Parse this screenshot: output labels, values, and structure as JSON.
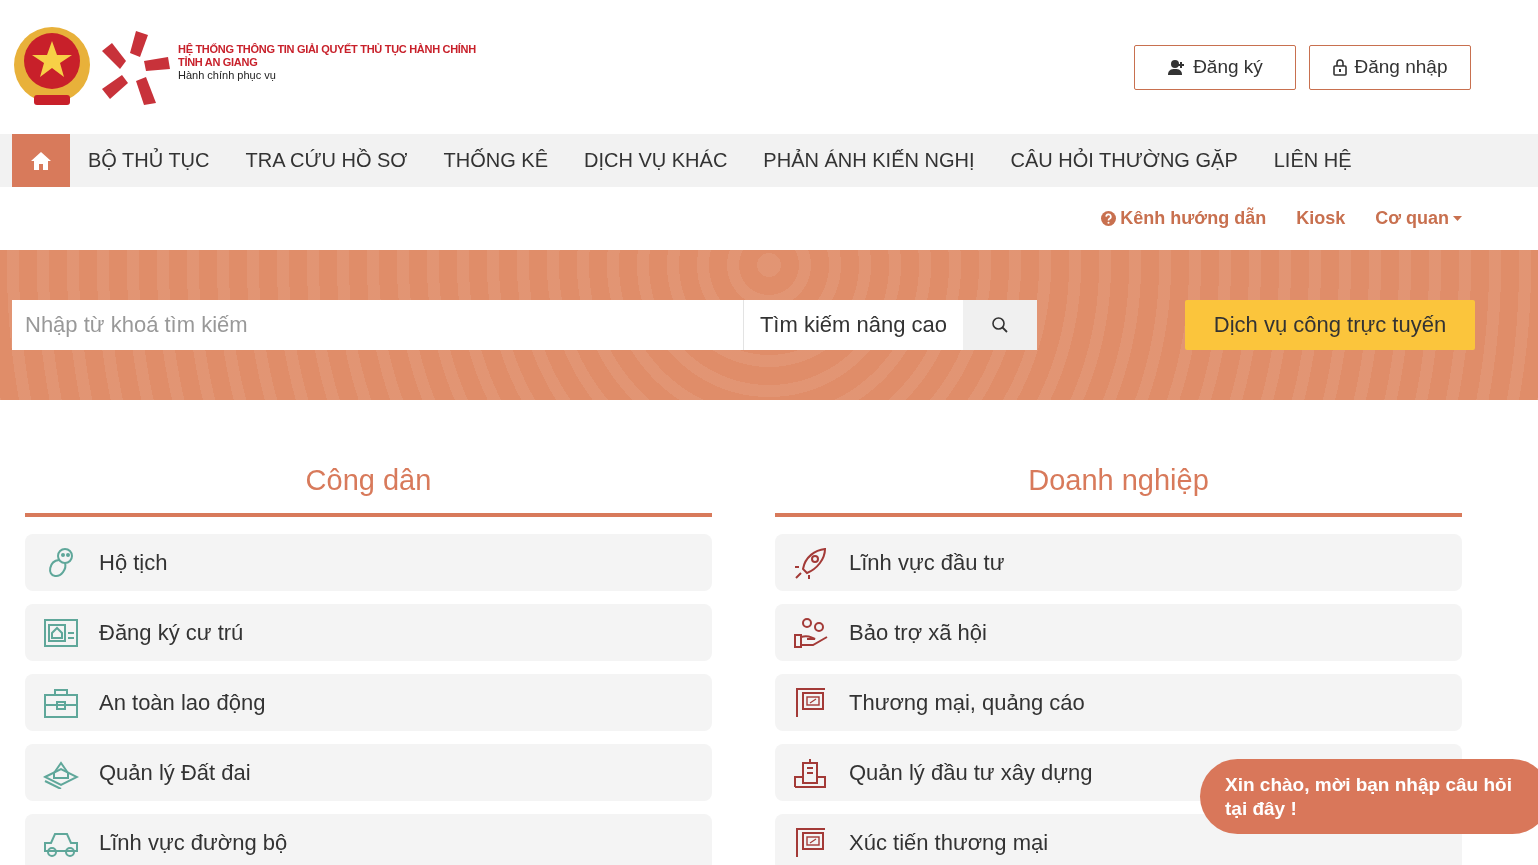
{
  "header": {
    "title_line1": "HỆ THỐNG THÔNG TIN GIẢI QUYẾT THỦ TỤC HÀNH CHÍNH",
    "title_line2": "TỈNH AN GIANG",
    "slogan": "Hành chính phục vụ",
    "buttons": [
      {
        "kind": "register",
        "label": "Đăng ký"
      },
      {
        "kind": "login",
        "label": "Đăng nhập"
      }
    ]
  },
  "nav": [
    {
      "kind": "home",
      "selected": true
    },
    {
      "kind": "text",
      "label": "BỘ THỦ TỤC",
      "selected": false
    },
    {
      "kind": "text",
      "label": "TRA CỨU HỒ SƠ",
      "selected": false
    },
    {
      "kind": "text",
      "label": "THỐNG KÊ",
      "selected": false
    },
    {
      "kind": "text",
      "label": "DỊCH VỤ KHÁC",
      "selected": false
    },
    {
      "kind": "text",
      "label": "PHẢN ÁNH KIẾN NGHỊ",
      "selected": false
    },
    {
      "kind": "text",
      "label": "CÂU HỎI THƯỜNG GẶP",
      "selected": false
    },
    {
      "kind": "text",
      "label": "LIÊN HỆ",
      "selected": false
    }
  ],
  "sub_links": [
    {
      "kind": "help",
      "label": "Kênh hướng dẫn"
    },
    {
      "kind": "plain",
      "label": "Kiosk"
    },
    {
      "kind": "dropdown",
      "label": "Cơ quan"
    }
  ],
  "search": {
    "placeholder": "Nhập từ khoá tìm kiếm",
    "advanced": "Tìm kiếm nâng cao",
    "online_service": "Dịch vụ công trực tuyến"
  },
  "sections": [
    {
      "title": "Công dân",
      "items": [
        {
          "kind": "baby",
          "label": "Hộ tịch"
        },
        {
          "kind": "id-card",
          "label": "Đăng ký cư trú"
        },
        {
          "kind": "briefcase",
          "label": "An toàn lao động"
        },
        {
          "kind": "land",
          "label": "Quản lý Đất đai"
        },
        {
          "kind": "car",
          "label": "Lĩnh vực đường bộ"
        }
      ]
    },
    {
      "title": "Doanh nghiệp",
      "items": [
        {
          "kind": "rocket",
          "label": "Lĩnh vực đầu tư"
        },
        {
          "kind": "hand",
          "label": "Bảo trợ xã hội"
        },
        {
          "kind": "sign",
          "label": "Thương mại, quảng cáo"
        },
        {
          "kind": "building",
          "label": "Quản lý đầu tư xây dựng"
        },
        {
          "kind": "sign",
          "label": "Xúc tiến thương mại"
        }
      ]
    }
  ],
  "chat": {
    "text": "Xin chào, mời bạn nhập câu hỏi tại đây !"
  }
}
